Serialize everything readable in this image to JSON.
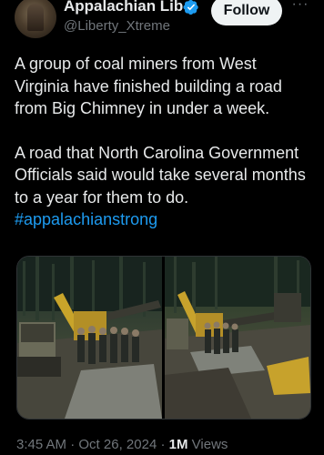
{
  "author": {
    "name": "Appalachian Liberty",
    "handle": "@Liberty_Xtreme",
    "verified": true
  },
  "actions": {
    "follow_label": "Follow",
    "more_label": "···"
  },
  "post": {
    "paragraph1": "A group of coal miners from West Virginia have finished building a road from Big Chimney in under a week.",
    "paragraph2_text": "A road that North Carolina Government Officials said would take several months to a year for them to do. ",
    "hashtag": "#appalachianstrong"
  },
  "media": {
    "count": 2
  },
  "meta": {
    "time": "3:45 AM",
    "separator": "·",
    "date": "Oct 26, 2024",
    "views_count": "1M",
    "views_label": "Views"
  },
  "colors": {
    "background": "#000000",
    "text": "#e7e9ea",
    "secondary": "#71767b",
    "link": "#1d9bf0",
    "verified": "#1d9bf0"
  }
}
